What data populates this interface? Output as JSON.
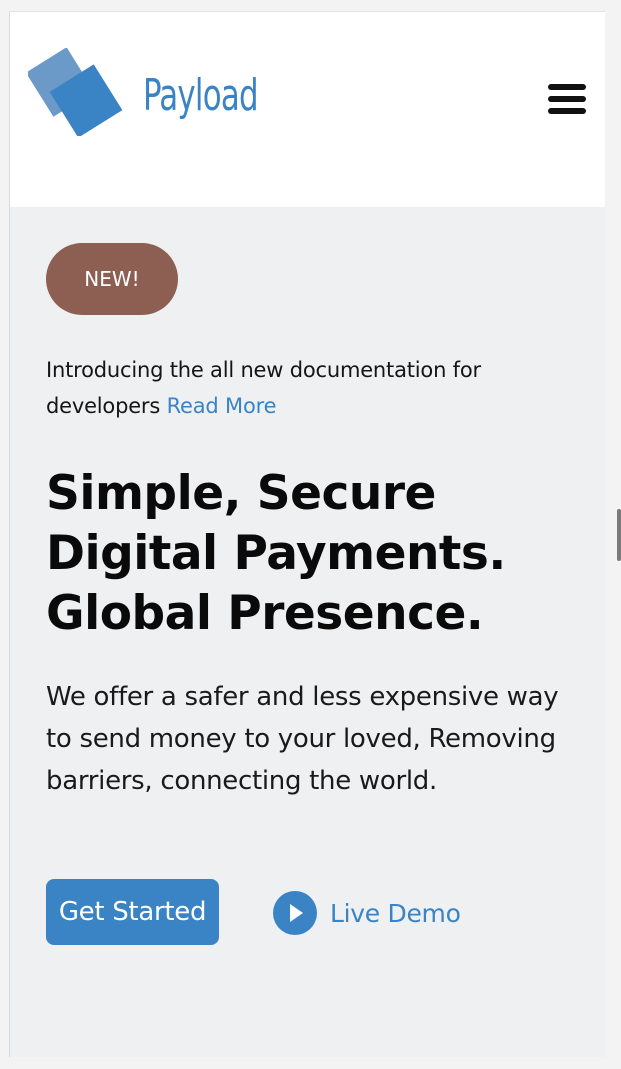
{
  "header": {
    "brand": "Payload",
    "logo_icon": "overlapping-squares-logo",
    "menu_icon": "hamburger-menu-icon"
  },
  "hero": {
    "badge": "NEW!",
    "intro_text": "Introducing the all new documentation for developers",
    "read_more": "Read More",
    "headline": "Simple, Secure Digital Payments. Global Presence.",
    "description": "We offer a safer and less expensive way to send money to your loved, Removing barriers, connecting the world.",
    "cta_label": "Get Started",
    "demo_label": "Live Demo",
    "demo_icon": "play-circle-icon"
  },
  "colors": {
    "accent": "#3a84c5",
    "badge": "#8d5e52",
    "background": "#eff0f2",
    "header_bg": "#ffffff"
  }
}
